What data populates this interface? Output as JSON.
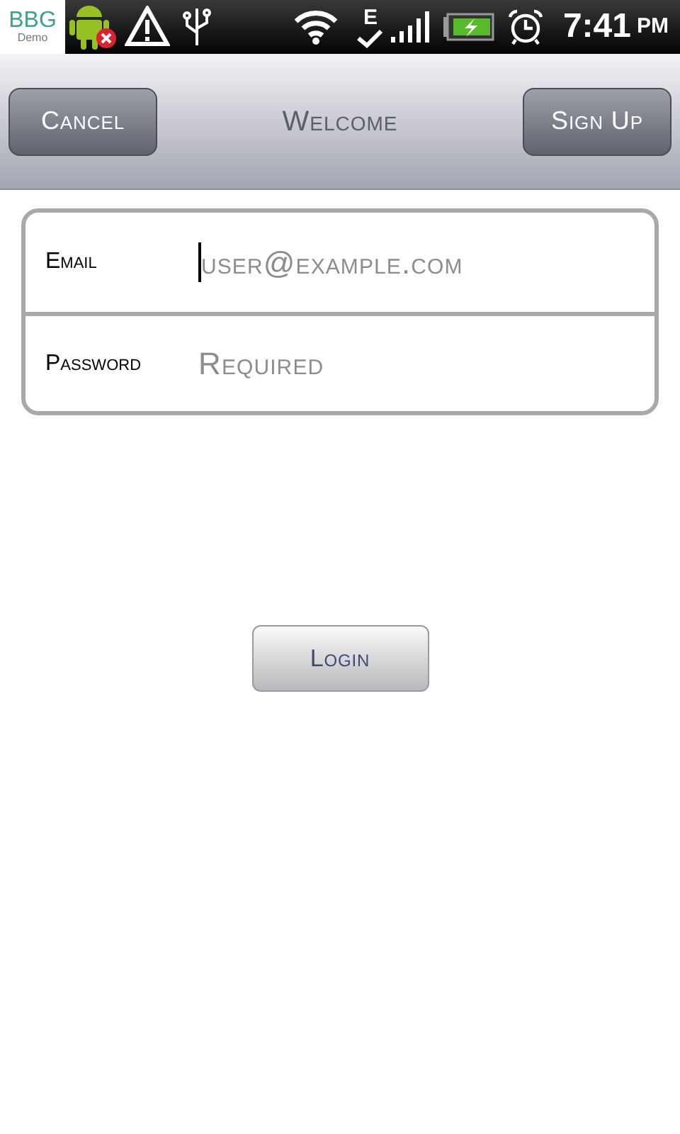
{
  "status_bar": {
    "app_badge": {
      "title": "BBG",
      "subtitle": "Demo"
    },
    "network_letter": "E",
    "time": "7:41",
    "meridiem": "PM"
  },
  "nav_bar": {
    "left_button": "Cancel",
    "title": "Welcome",
    "right_button": "Sign Up"
  },
  "form": {
    "fields": [
      {
        "label": "Email",
        "placeholder": "user@example.com",
        "focused": true
      },
      {
        "label": "Password",
        "placeholder": "Required",
        "focused": false
      }
    ]
  },
  "login_button": "Login"
}
